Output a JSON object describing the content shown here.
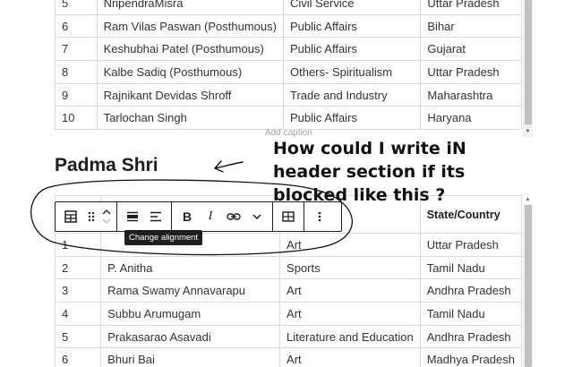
{
  "top_table": {
    "rows": [
      [
        "5",
        "NripendraMisra",
        "Civil Service",
        "Uttar Pradesh"
      ],
      [
        "6",
        "Ram Vilas Paswan (Posthumous)",
        "Public Affairs",
        "Bihar"
      ],
      [
        "7",
        "Keshubhai Patel (Posthumous)",
        "Public Affairs",
        "Gujarat"
      ],
      [
        "8",
        "Kalbe Sadiq (Posthumous)",
        "Others- Spiritualism",
        "Uttar Pradesh"
      ],
      [
        "9",
        "Rajnikant Devidas Shroff",
        "Trade and Industry",
        "Maharashtra"
      ],
      [
        "10",
        "Tarlochan Singh",
        "Public Affairs",
        "Haryana"
      ]
    ],
    "caption_placeholder": "Add caption"
  },
  "heading": "Padma Shri",
  "annotation": {
    "text": "How could I write iN header section if its blocked like this ?"
  },
  "bottom_table": {
    "header": [
      "",
      "",
      "",
      "State/Country"
    ],
    "rows": [
      [
        "1",
        "",
        "Art",
        "Uttar Pradesh"
      ],
      [
        "2",
        "P. Anitha",
        "Sports",
        "Tamil Nadu"
      ],
      [
        "3",
        "Rama Swamy Annavarapu",
        "Art",
        "Andhra Pradesh"
      ],
      [
        "4",
        "Subbu Arumugam",
        "Art",
        "Tamil Nadu"
      ],
      [
        "5",
        "Prakasarao Asavadi",
        "Literature and Education",
        "Andhra Pradesh"
      ],
      [
        "6",
        "Bhuri Bai",
        "Art",
        "Madhya Pradesh"
      ]
    ]
  },
  "toolbar": {
    "buttons": [
      {
        "name": "table-block-icon"
      },
      {
        "name": "drag-handle-icon"
      },
      {
        "name": "move-up-down-icon"
      },
      {
        "name": "align-block-icon"
      },
      {
        "name": "align-text-icon"
      },
      {
        "name": "bold-icon",
        "label": "B"
      },
      {
        "name": "italic-icon",
        "label": "I"
      },
      {
        "name": "link-icon"
      },
      {
        "name": "more-formats-chevron-icon"
      },
      {
        "name": "edit-table-icon"
      },
      {
        "name": "options-kebab-icon"
      }
    ],
    "tooltip": "Change alignment"
  },
  "colors": {
    "grid_border": "#dcdcdc",
    "toolbar_border": "#1e1e1e",
    "tooltip_bg": "#1e1e1e",
    "caption": "#a0a0a0"
  }
}
